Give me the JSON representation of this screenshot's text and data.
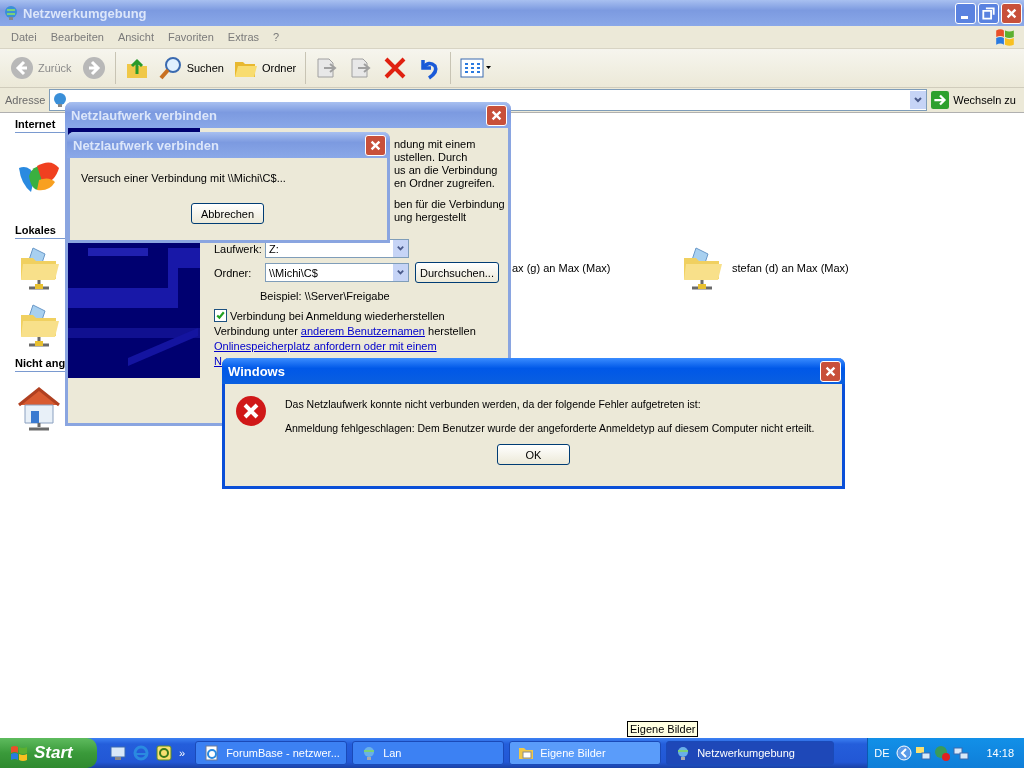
{
  "window": {
    "title": "Netzwerkumgebung",
    "active": false
  },
  "menu": [
    "Datei",
    "Bearbeiten",
    "Ansicht",
    "Favoriten",
    "Extras",
    "?"
  ],
  "toolbar": [
    {
      "kind": "back",
      "label": "Zurück",
      "disabled": true
    },
    {
      "kind": "forward",
      "disabled": true
    },
    {
      "kind": "up"
    },
    {
      "kind": "search",
      "label": "Suchen"
    },
    {
      "kind": "folders",
      "label": "Ordner"
    },
    {
      "kind": "move",
      "disabled": true
    },
    {
      "kind": "copy",
      "disabled": true
    },
    {
      "kind": "delete"
    },
    {
      "kind": "undo"
    },
    {
      "kind": "views"
    }
  ],
  "address": {
    "label": "Adresse",
    "go": "Wechseln zu"
  },
  "groups": [
    {
      "title": "Internet",
      "rows": [
        [
          {
            "kind": "msn"
          }
        ]
      ]
    },
    {
      "title": "Lokales",
      "rows": [
        [
          {
            "kind": "share"
          },
          {
            "kind": "text",
            "label": "ax (g) an Max (Max)"
          },
          {
            "kind": "share",
            "label": "stefan (d) an Max (Max)"
          }
        ],
        [
          {
            "kind": "share"
          }
        ]
      ]
    },
    {
      "title": "Nicht ang",
      "rows": [
        [
          {
            "kind": "home"
          }
        ]
      ]
    }
  ],
  "connect_dialog": {
    "title": "Netzlaufwerk verbinden",
    "active": false,
    "intro": [
      "ndung mit einem",
      "ustellen. Durch",
      "us an die Verbindung",
      "en Ordner zugreifen."
    ],
    "intro2": [
      "ben für die Verbindung",
      "ung hergestellt"
    ],
    "drive_label": "Laufwerk:",
    "drive": "Z:",
    "folder_label": "Ordner:",
    "folder": "\\\\Michi\\C$",
    "browse": "Durchsuchen...",
    "example": "Beispiel: \\\\Server\\Freigabe",
    "reconnect": {
      "label": "Verbindung bei Anmeldung wiederherstellen",
      "checked": true
    },
    "other_user": {
      "before": "Verbindung unter",
      "link": "anderem Benutzernamen",
      "after": "herstellen"
    },
    "links": [
      "Onlinespeicherplatz anfordern oder mit einem",
      "N"
    ]
  },
  "progress_dialog": {
    "title": "Netzlaufwerk verbinden",
    "active": false,
    "message": "Versuch einer Verbindung mit \\\\Michi\\C$...",
    "cancel": "Abbrechen"
  },
  "error_dialog": {
    "title": "Windows",
    "active": true,
    "lines": [
      "Das Netzlaufwerk konnte nicht verbunden werden, da der folgende Fehler aufgetreten ist:",
      "Anmeldung fehlgeschlagen: Dem Benutzer wurde der angeforderte Anmeldetyp auf diesem Computer nicht erteilt."
    ],
    "ok": "OK"
  },
  "taskbar": {
    "start": "Start",
    "more": "»",
    "tasks": [
      {
        "kind": "browser",
        "label": "ForumBase - netzwer...",
        "selected": false,
        "hover": false
      },
      {
        "kind": "network",
        "label": "Lan",
        "selected": false,
        "hover": false
      },
      {
        "kind": "folder",
        "label": "Eigene Bilder",
        "selected": false,
        "hover": true
      },
      {
        "kind": "network",
        "label": "Netzwerkumgebung",
        "selected": true,
        "hover": false
      }
    ],
    "language": "DE",
    "clock": "14:18"
  },
  "tooltip": "Eigene Bilder"
}
